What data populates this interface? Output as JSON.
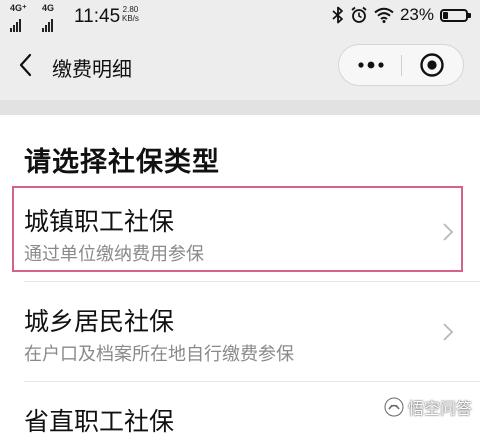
{
  "status_bar": {
    "signal1": "4G⁺",
    "signal2": "4G",
    "time": "11:45",
    "speed_value": "2.80",
    "speed_unit": "KB/s",
    "battery": "23%",
    "battery_level": 0.23
  },
  "nav": {
    "title": "缴费明细",
    "icons": [
      "back-icon",
      "more-icon",
      "target-icon"
    ]
  },
  "page": {
    "section_title": "请选择社保类型",
    "items": [
      {
        "title": "城镇职工社保",
        "subtitle": "通过单位缴纳费用参保"
      },
      {
        "title": "城乡居民社保",
        "subtitle": "在户口及档案所在地自行缴费参保"
      },
      {
        "title": "省直职工社保",
        "subtitle": ""
      }
    ]
  },
  "watermark": {
    "text": "悟空问答"
  },
  "colors": {
    "highlight": "#d4628d",
    "nav_bg": "#ededed",
    "subtitle": "#8a8a8a"
  }
}
